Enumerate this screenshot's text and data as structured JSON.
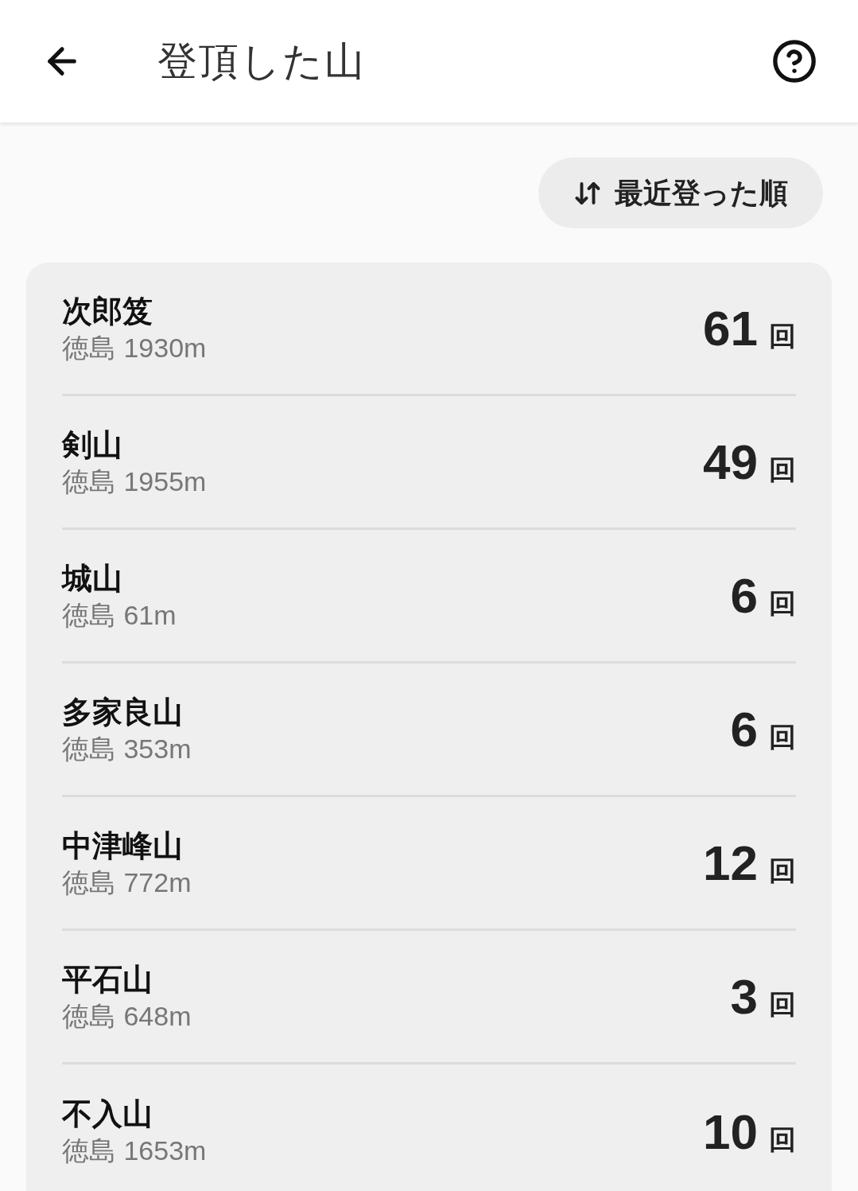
{
  "header": {
    "title": "登頂した山"
  },
  "sort_button": {
    "label": "最近登った順"
  },
  "mountains": [
    {
      "name": "次郎笈",
      "detail": "徳島 1930m",
      "count": "61",
      "unit": "回"
    },
    {
      "name": "剣山",
      "detail": "徳島 1955m",
      "count": "49",
      "unit": "回"
    },
    {
      "name": "城山",
      "detail": "徳島 61m",
      "count": "6",
      "unit": "回"
    },
    {
      "name": "多家良山",
      "detail": "徳島 353m",
      "count": "6",
      "unit": "回"
    },
    {
      "name": "中津峰山",
      "detail": "徳島 772m",
      "count": "12",
      "unit": "回"
    },
    {
      "name": "平石山",
      "detail": "徳島 648m",
      "count": "3",
      "unit": "回"
    },
    {
      "name": "不入山",
      "detail": "徳島 1653m",
      "count": "10",
      "unit": "回"
    }
  ]
}
